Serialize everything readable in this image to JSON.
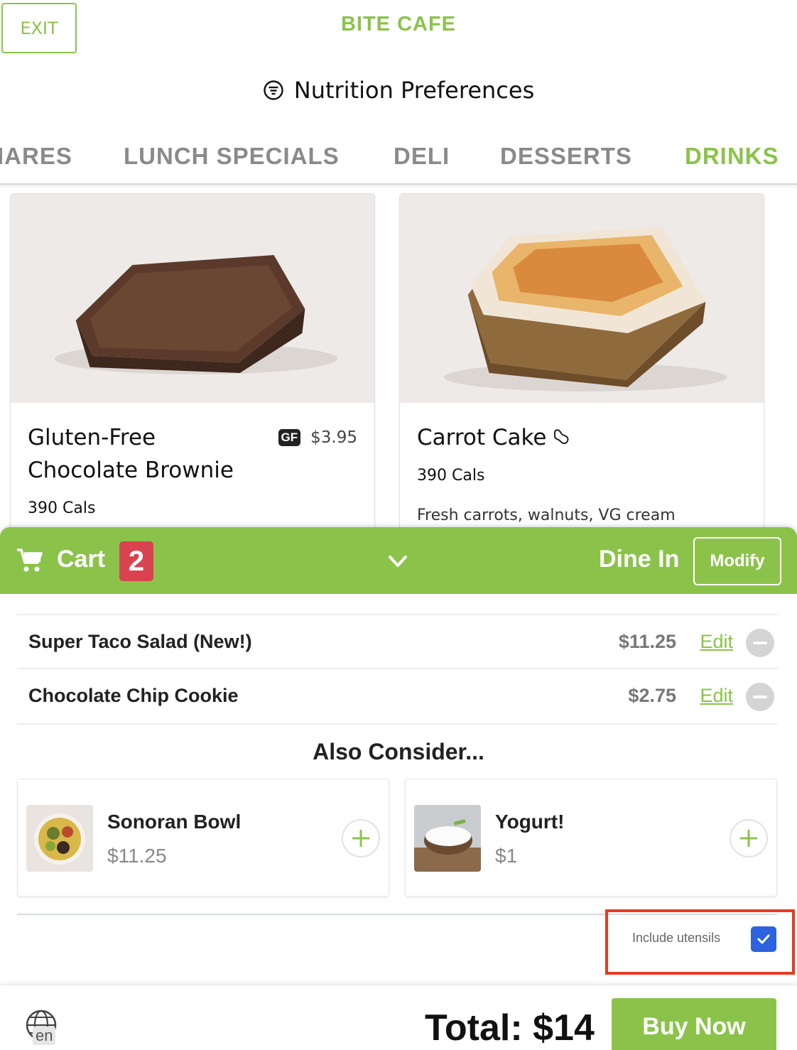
{
  "header": {
    "exit_label": "EXIT",
    "title": "BITE CAFE",
    "nutrition_label": "Nutrition Preferences"
  },
  "tabs": [
    {
      "label": "IARES",
      "active": false
    },
    {
      "label": "LUNCH SPECIALS",
      "active": false
    },
    {
      "label": "DELI",
      "active": false
    },
    {
      "label": "DESSERTS",
      "active": false
    },
    {
      "label": "DRINKS",
      "active": true
    }
  ],
  "products": [
    {
      "name_line1": "Gluten-Free",
      "name_line2": "Chocolate Brownie",
      "calories": "390 Cals",
      "badge": "GF",
      "price": "$3.95",
      "image": "brownie"
    },
    {
      "name": "Carrot Cake",
      "icon": "peanut-icon",
      "calories": "390 Cals",
      "description": "Fresh carrots, walnuts, VG cream",
      "image": "carrot-cake"
    }
  ],
  "cart": {
    "label": "Cart",
    "count": "2",
    "order_type": "Dine In",
    "modify_label": "Modify",
    "items": [
      {
        "name": "Super Taco Salad (New!)",
        "price": "$11.25",
        "edit_label": "Edit"
      },
      {
        "name": "Chocolate Chip Cookie",
        "price": "$2.75",
        "edit_label": "Edit"
      }
    ]
  },
  "suggestions": {
    "title": "Also Consider...",
    "items": [
      {
        "name": "Sonoran Bowl",
        "price": "$11.25"
      },
      {
        "name": "Yogurt!",
        "price": "$1"
      }
    ]
  },
  "utensils": {
    "label": "Include utensils",
    "checked": true
  },
  "footer": {
    "language": "en",
    "total": "Total: $14",
    "buy_label": "Buy Now"
  },
  "colors": {
    "accent": "#8bc34a",
    "badge": "#d9434f",
    "checkbox": "#2d62e0",
    "highlight": "#e53b24"
  }
}
